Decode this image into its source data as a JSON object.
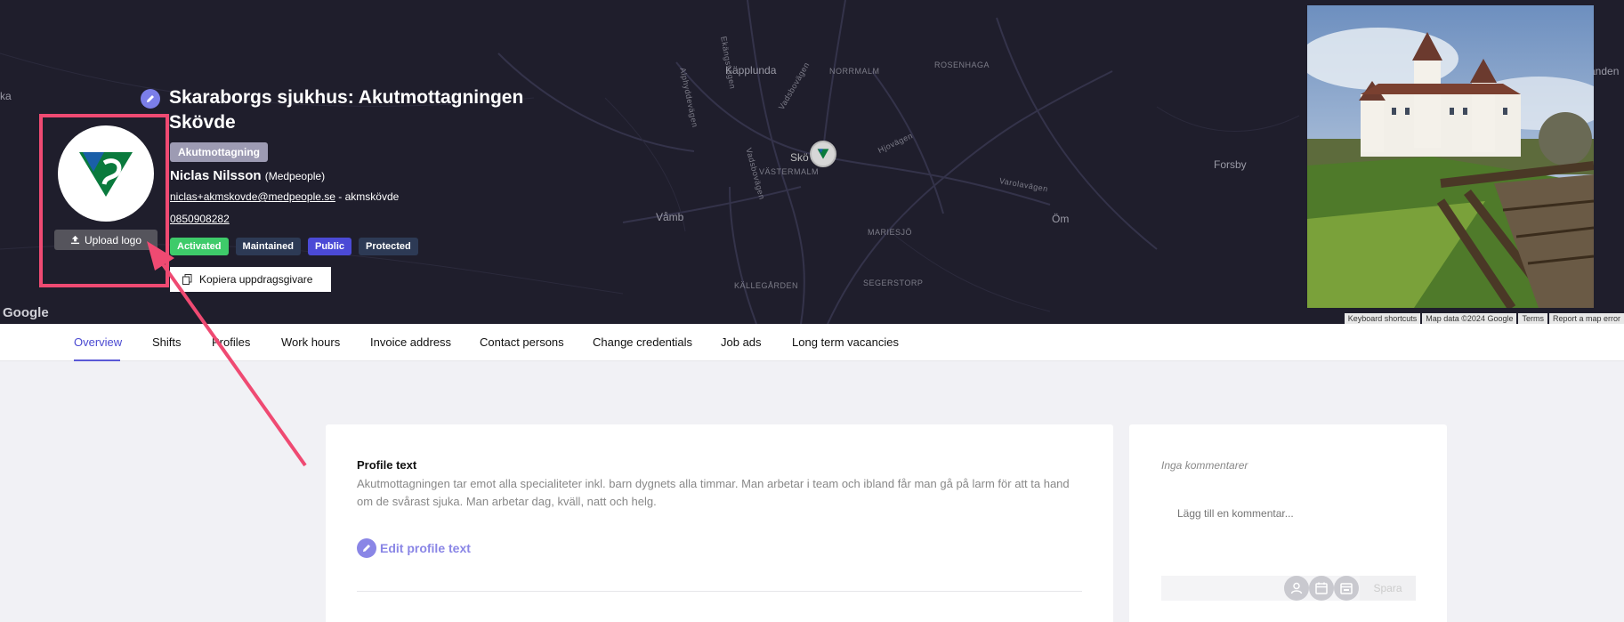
{
  "map": {
    "labels": {
      "kapplunda": "Käpplunda",
      "norrmalm": "NORRMALM",
      "rosenhaga": "ROSENHAGA",
      "skovde_short": "Skö",
      "vastermalm": "VÄSTERMALM",
      "vamb": "Våmb",
      "mariesjo": "MARIESJÖ",
      "kallegarden": "KÄLLEGÅRDEN",
      "segerstorp": "SEGERSTORP",
      "forsby": "Forsby",
      "om": "Öm",
      "ka": "ka",
      "anden": "anden",
      "ekangsvagen": "Ekängsvägen",
      "alphyddevagen": "Alphyddevägen",
      "vadsbovagen": "Vadsbovägen",
      "vadsbovagen2": "Vadsbovägen",
      "hjovagen": "Hjovägen",
      "varolavagen": "Varolavägen"
    },
    "google": "Google",
    "footer": [
      "Keyboard shortcuts",
      "Map data ©2024 Google",
      "Terms",
      "Report a map error"
    ]
  },
  "header": {
    "title": "Skaraborgs sjukhus: Akutmottagningen Skövde",
    "category_tag": "Akutmottagning",
    "contact": {
      "name": "Niclas Nilsson",
      "org": "(Medpeople)",
      "email": "niclas+akmskovde@medpeople.se",
      "email_suffix": " - akmskövde",
      "phone": "0850908282"
    },
    "badges": [
      {
        "label": "Activated",
        "color": "#3ecb6a"
      },
      {
        "label": "Maintained",
        "color": "#2d3a55"
      },
      {
        "label": "Public",
        "color": "#4b4ad6"
      },
      {
        "label": "Protected",
        "color": "#2d3a55"
      }
    ],
    "copy_button": "Kopiera uppdragsgivare",
    "upload_logo": "Upload logo"
  },
  "tabs": [
    {
      "label": "Overview",
      "active": true
    },
    {
      "label": "Shifts"
    },
    {
      "label": "Profiles"
    },
    {
      "label": "Work hours"
    },
    {
      "label": "Invoice address"
    },
    {
      "label": "Contact persons"
    },
    {
      "label": "Change credentials"
    },
    {
      "label": "Job ads"
    },
    {
      "label": "Long term vacancies"
    }
  ],
  "profile": {
    "label": "Profile text",
    "text": "Akutmottagningen tar emot alla specialiteter inkl. barn dygnets alla timmar. Man arbetar i team och ibland får man gå på larm för att ta hand om de svårast sjuka. Man arbetar dag, kväll, natt och helg.",
    "edit_label": "Edit profile text"
  },
  "comments": {
    "empty_label": "Inga kommentarer",
    "input_placeholder": "Lägg till en kommentar...",
    "save_label": "Spara"
  },
  "colors": {
    "accent": "#4a49d1",
    "highlight": "#ef4a72",
    "map_bg": "#1f1e2c"
  }
}
